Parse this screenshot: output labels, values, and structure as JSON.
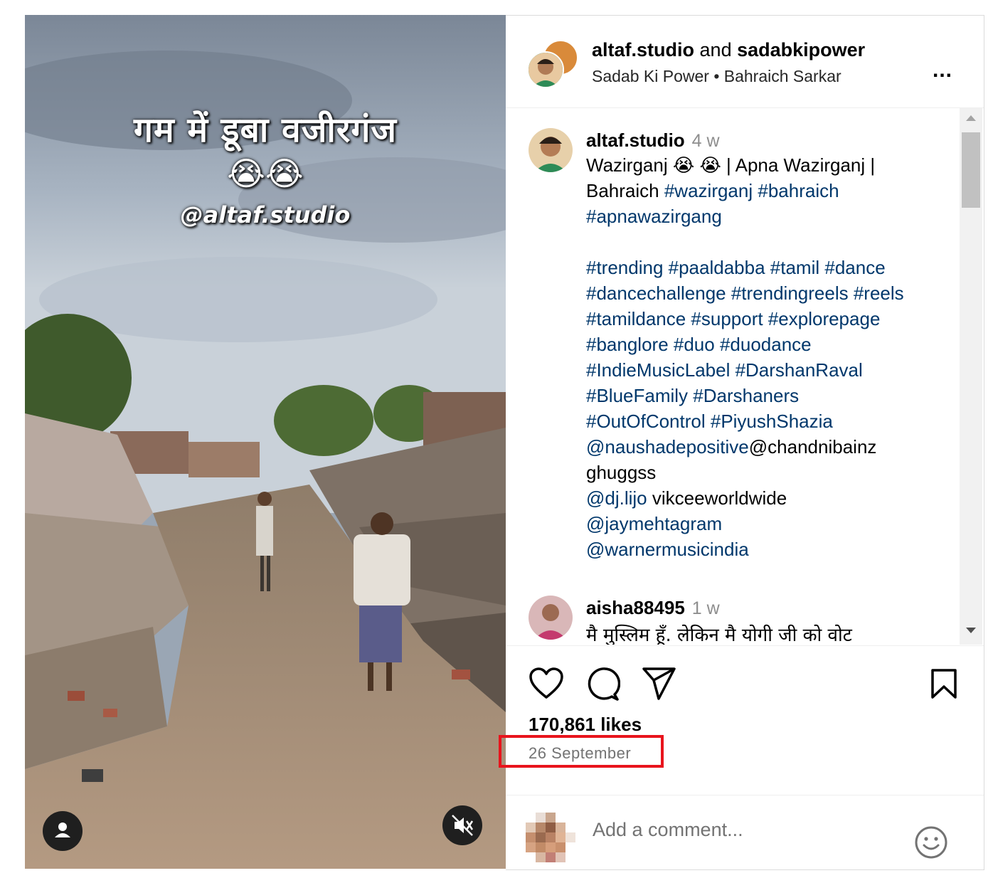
{
  "media": {
    "overlay_line1": "गम में डूबा वजीरगंज",
    "overlay_emojis": "😭😭",
    "overlay_handle": "@altaf.studio",
    "profile_button_icon": "person-icon",
    "mute_button_icon": "muted-speaker-icon"
  },
  "header": {
    "user1": "altaf.studio",
    "joiner": "and",
    "user2": "sadabkipower",
    "subtitle": "Sadab Ki Power • Bahraich Sarkar",
    "more_label": "..."
  },
  "post": {
    "author": "altaf.studio",
    "time": "4 w",
    "caption_lines": [
      [
        {
          "t": "Wazirganj 😭 😭 | Apna Wazirganj |",
          "tag": false
        }
      ],
      [
        {
          "t": "Bahraich ",
          "tag": false
        },
        {
          "t": "#wazirganj #bahraich",
          "tag": true
        }
      ],
      [
        {
          "t": "#apnawazirgang",
          "tag": true
        }
      ],
      [
        {
          "t": " ",
          "tag": false
        }
      ],
      [
        {
          "t": "#trending #paaldabba #tamil #dance",
          "tag": true
        }
      ],
      [
        {
          "t": "#dancechallenge #trendingreels #reels",
          "tag": true
        }
      ],
      [
        {
          "t": "#tamildance #support #explorepage",
          "tag": true
        }
      ],
      [
        {
          "t": "#banglore #duo #duodance",
          "tag": true
        }
      ],
      [
        {
          "t": "#IndieMusicLabel #DarshanRaval",
          "tag": true
        }
      ],
      [
        {
          "t": "#BlueFamily #Darshaners",
          "tag": true
        }
      ],
      [
        {
          "t": "#OutOfControl #PiyushShazia",
          "tag": true
        }
      ],
      [
        {
          "t": "@naushadepositive",
          "tag": true
        },
        {
          "t": "@chandnibainz",
          "tag": false
        }
      ],
      [
        {
          "t": "ghuggss",
          "tag": false
        }
      ],
      [
        {
          "t": "@dj.lijo",
          "tag": true
        },
        {
          "t": " vikceeworldwide",
          "tag": false
        }
      ],
      [
        {
          "t": "@jaymehtagram",
          "tag": true
        }
      ],
      [
        {
          "t": "@warnermusicindia",
          "tag": true
        }
      ]
    ]
  },
  "comment": {
    "author": "aisha88495",
    "time": "1 w",
    "text": "मै मुस्लिम हूँ. लेकिन मै योगी जी को वोट"
  },
  "actions": {
    "likes": "170,861 likes",
    "date": "26 September",
    "icons": [
      "heart-icon",
      "comment-icon",
      "share-icon",
      "bookmark-icon"
    ]
  },
  "comment_box": {
    "placeholder": "Add a comment...",
    "emoji_icon": "smiley-icon"
  },
  "colors": {
    "hashtag": "#00376b",
    "highlight_box": "#e8141c",
    "muted_text": "#737373"
  }
}
